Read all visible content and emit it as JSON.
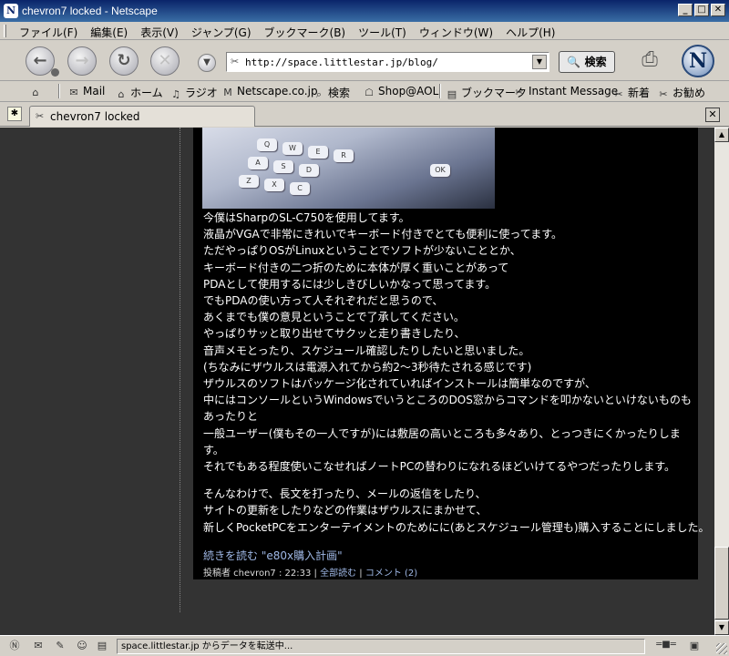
{
  "window": {
    "title": "chevron7 locked - Netscape",
    "app_icon": "N",
    "minimize": "_",
    "maximize": "□",
    "close": "✕"
  },
  "menu": [
    "ファイル(F)",
    "編集(E)",
    "表示(V)",
    "ジャンプ(G)",
    "ブックマーク(B)",
    "ツール(T)",
    "ウィンドウ(W)",
    "ヘルプ(H)"
  ],
  "navigation": {
    "back_icon": "back-arrow-icon",
    "forward_icon": "forward-arrow-icon",
    "reload_icon": "reload-icon",
    "stop_icon": "stop-icon",
    "url": "http://space.littlestar.jp/blog/",
    "search_label": "検索",
    "logo": "N"
  },
  "personal_toolbar": {
    "items": [
      "Mail",
      "ホーム",
      "ラジオ",
      "Netscape.co.jp",
      "検索",
      "Shop@AOL",
      "ブックマーク",
      "Instant Message",
      "新着",
      "お勧め"
    ]
  },
  "tab": {
    "label": "chevron7 locked"
  },
  "post": {
    "paragraph1": [
      "今僕はSharpのSL-C750を使用してます。",
      "液晶がVGAで非常にきれいでキーボード付きでとても便利に使ってます。",
      "ただやっぱりOSがLinuxということでソフトが少ないこととか、",
      "キーボード付きの二つ折のために本体が厚く重いことがあって",
      "PDAとして使用するには少しきびしいかなって思ってます。",
      "でもPDAの使い方って人それぞれだと思うので、",
      "あくまでも僕の意見ということで了承してください。",
      "やっぱりサッと取り出せてサクッと走り書きしたり、",
      "音声メモとったり、スケジュール確認したりしたいと思いました。",
      "(ちなみにザウルスは電源入れてから約2～3秒待たされる感じです)",
      "ザウルスのソフトはパッケージ化されていればインストールは簡単なのですが、",
      "中にはコンソールというWindowsでいうところのDOS窓からコマンドを叩かないといけないものも",
      "あったりと",
      "一般ユーザー(僕もその一人ですが)には敷居の高いところも多々あり、とっつきにくかったりしま",
      "す。",
      "それでもある程度使いこなせればノートPCの替わりになれるほどいけてるやつだったりします。"
    ],
    "paragraph2": [
      "そんなわけで、長文を打ったり、メールの返信をしたり、",
      "サイトの更新をしたりなどの作業はザウルスにまかせて、",
      "新しくPocketPCをエンターテイメントのためにに(あとスケジュール管理も)購入することにしました。"
    ],
    "read_more": "続きを読む \"e80x購入計画\"",
    "meta": {
      "posted_by": "投稿者 chevron7 : 22:33",
      "separator1": "|",
      "full_read": "全部読む",
      "separator2": "|",
      "comments": "コメント (2)"
    },
    "image_keys": [
      "Q",
      "W",
      "E",
      "R",
      "A",
      "S",
      "D",
      "Z",
      "X",
      "C",
      "OK"
    ]
  },
  "status": {
    "text": "space.littlestar.jp からデータを転送中..."
  }
}
